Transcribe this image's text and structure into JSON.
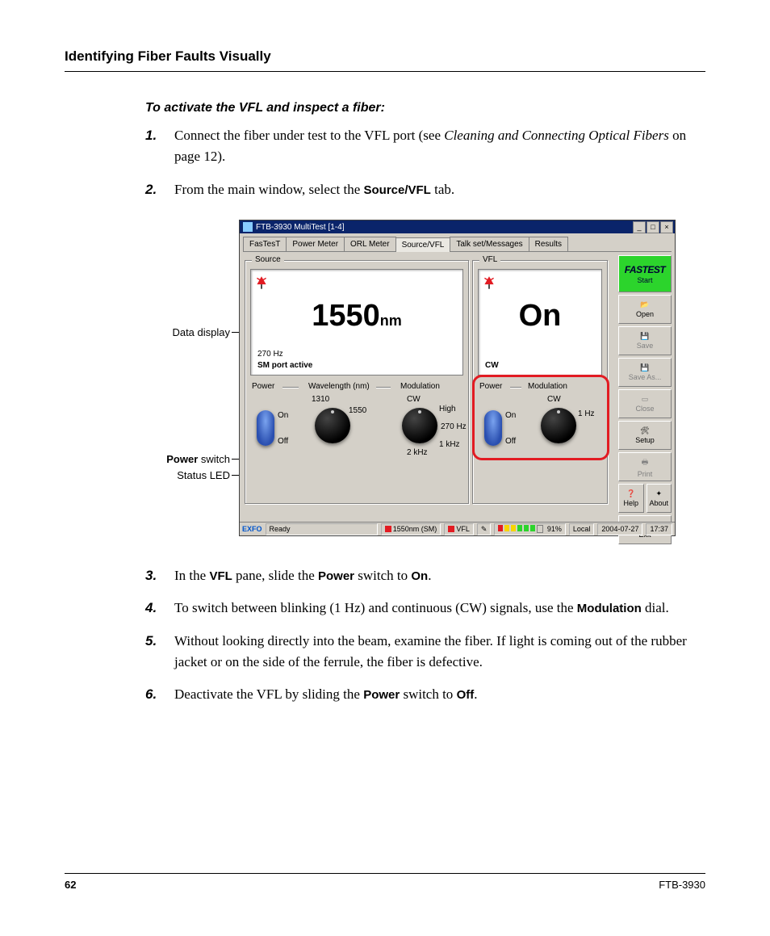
{
  "header": "Identifying Fiber Faults Visually",
  "subhead": "To activate the VFL and inspect a fiber:",
  "steps_top": [
    {
      "n": "1.",
      "html": "Connect the fiber under test to the VFL port (see <i>Cleaning and Connecting Optical Fibers</i> on page 12)."
    },
    {
      "n": "2.",
      "html": "From the main window, select the <b>Source/VFL</b> tab."
    }
  ],
  "steps_bottom": [
    {
      "n": "3.",
      "html": "In the <b>VFL</b> pane, slide the <b>Power</b> switch to <b>On</b>."
    },
    {
      "n": "4.",
      "html": "To switch between blinking (1 Hz) and continuous (CW) signals, use the <b>Modulation</b> dial."
    },
    {
      "n": "5.",
      "html": "Without looking directly into the beam, examine the fiber. If light is coming out of the rubber jacket or on the side of the ferrule, the fiber is defective."
    },
    {
      "n": "6.",
      "html": "Deactivate the VFL by sliding the <b>Power</b> switch to <b>Off</b>."
    }
  ],
  "callouts": {
    "data_display": "Data display",
    "power_switch_pre": "Power",
    "power_switch_post": " switch",
    "status_led": "Status LED"
  },
  "app": {
    "title": "FTB-3930 MultiTest [1-4]",
    "tabs": [
      "FasTesT",
      "Power Meter",
      "ORL Meter",
      "Source/VFL",
      "Talk set/Messages",
      "Results"
    ],
    "active_tab": 3,
    "source": {
      "legend": "Source",
      "big": "1550",
      "big_unit": "nm",
      "line1": "270 Hz",
      "line2": "SM port active",
      "labels": {
        "power": "Power",
        "wavelength": "Wavelength (nm)",
        "modulation": "Modulation",
        "on": "On",
        "off": "Off",
        "w1310": "1310",
        "w1550": "1550",
        "cw": "CW",
        "high": "High",
        "hz270": "270 Hz",
        "khz1": "1 kHz",
        "khz2": "2 kHz"
      }
    },
    "vfl": {
      "legend": "VFL",
      "big": "On",
      "line1": "CW",
      "labels": {
        "power": "Power",
        "modulation": "Modulation",
        "on": "On",
        "off": "Off",
        "cw": "CW",
        "hz1": "1 Hz"
      }
    },
    "sidebar": {
      "fastest": "FASTEST",
      "start": "Start",
      "open": "Open",
      "save": "Save",
      "saveas": "Save As...",
      "close": "Close",
      "setup": "Setup",
      "print": "Print",
      "help": "Help",
      "about": "About",
      "exit": "Exit"
    },
    "status": {
      "brand": "EXFO",
      "ready": "Ready",
      "src": "1550nm (SM)",
      "vfl": "VFL",
      "pct": "91%",
      "mode": "Local",
      "date": "2004-07-27",
      "time": "17:37"
    }
  },
  "footer": {
    "page": "62",
    "model": "FTB-3930"
  }
}
